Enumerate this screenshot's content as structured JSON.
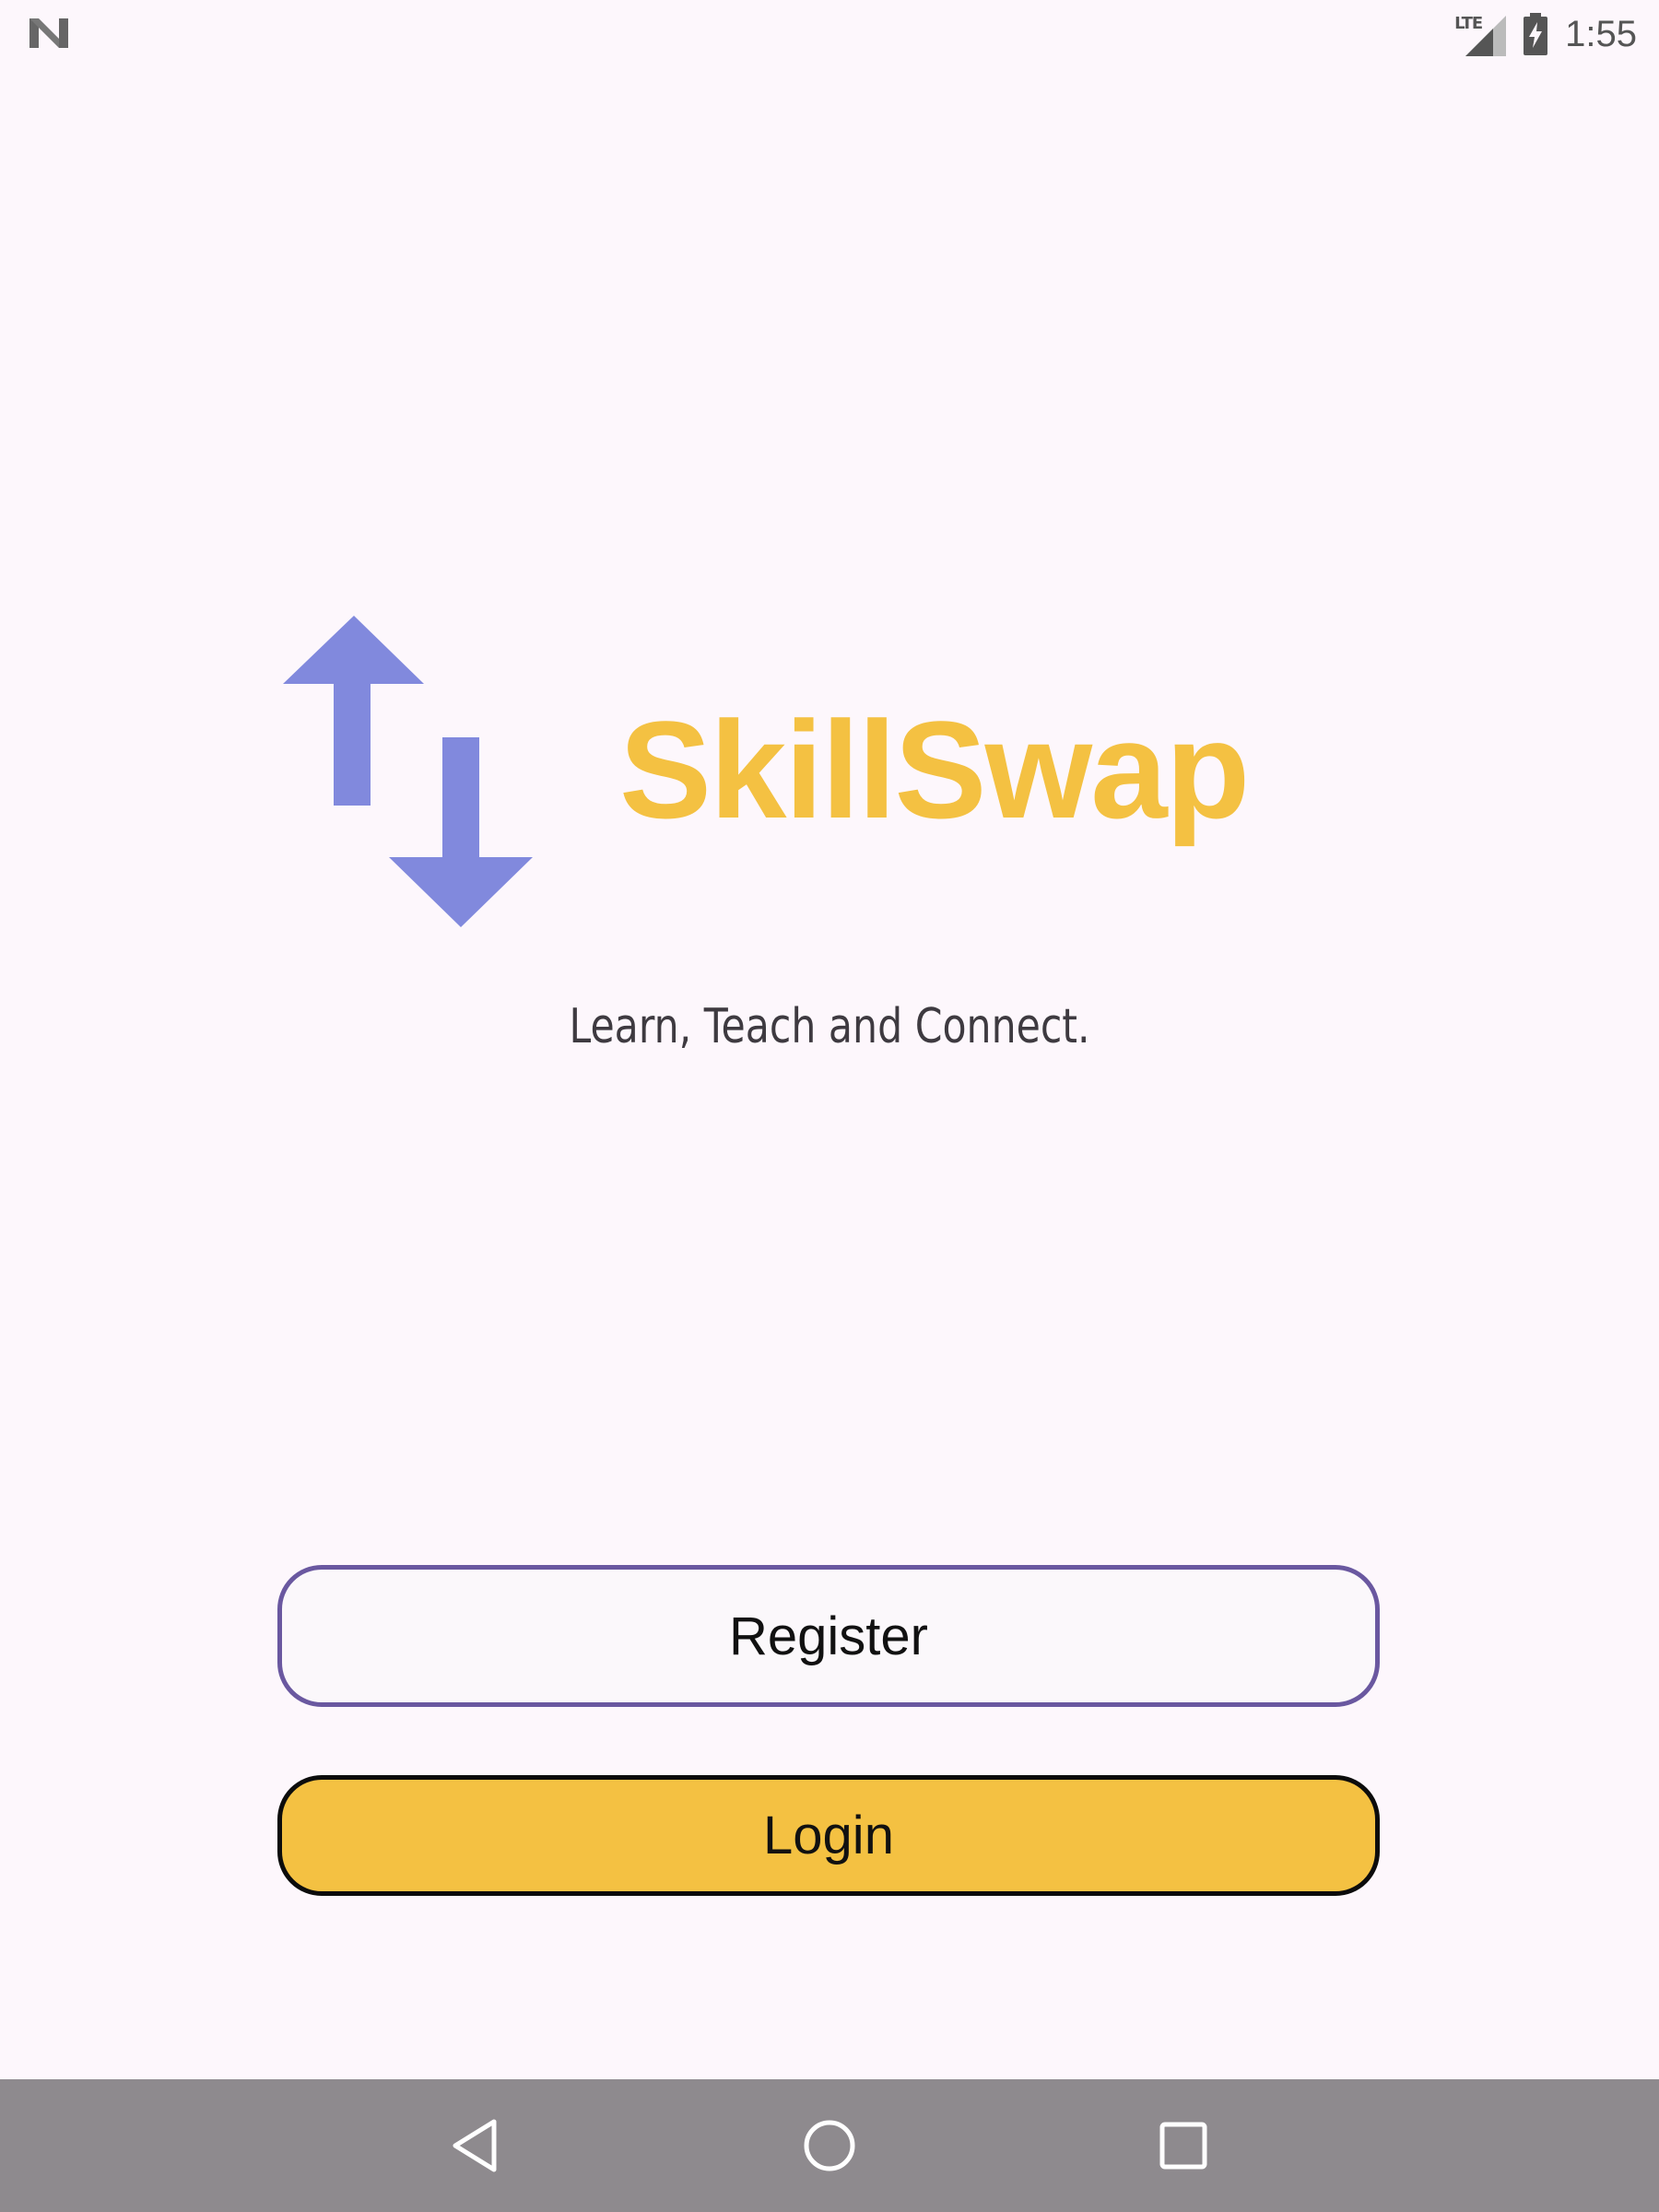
{
  "status_bar": {
    "notification_icon": "n-logo-icon",
    "network_label": "LTE",
    "signal_icon": "cell-signal-icon",
    "battery_icon": "battery-charging-icon",
    "time": "1:55"
  },
  "branding": {
    "logo_icon": "swap-arrows-icon",
    "app_name": "SkillSwap",
    "tagline": "Learn, Teach and Connect."
  },
  "actions": {
    "register_label": "Register",
    "login_label": "Login"
  },
  "nav_bar": {
    "back_icon": "back-triangle-icon",
    "home_icon": "home-circle-icon",
    "recents_icon": "recents-square-icon"
  },
  "colors": {
    "background": "#fdf7fc",
    "brand_yellow": "#f4c142",
    "logo_arrow": "#8189dd",
    "register_border": "#6a58a0",
    "nav_bar": "#8e8a8e"
  }
}
